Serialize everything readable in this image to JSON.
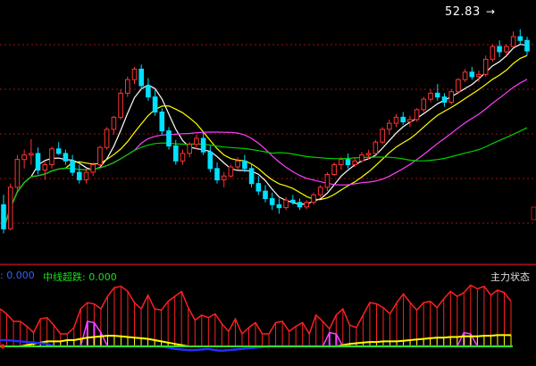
{
  "chart_data": {
    "type": "candlestick",
    "price_label": "52.83",
    "price_arrow": "→",
    "indicator_left_value": ": 0.000",
    "indicator_mid_label": "中线超跌",
    "indicator_mid_value": ": 0.000",
    "indicator_right_label": "主力状态",
    "colors": {
      "up": "#ff3333",
      "down": "#00e0ff",
      "ma5": "#ffffff",
      "ma10": "#ffff00",
      "ma20": "#ff40ff",
      "ma60": "#00d000",
      "grid": "#a01010",
      "ind_red": "#ff2020",
      "ind_magenta": "#ff40ff",
      "ind_yellow": "#ffff00",
      "ind_blue": "#2030ff",
      "ind_green": "#30e030"
    },
    "price_ylim": [
      23,
      55
    ],
    "ind_ylim": [
      0,
      100
    ],
    "candles": [
      [
        30.2,
        31.5,
        26.4,
        27.0
      ],
      [
        27.0,
        33.0,
        26.8,
        32.5
      ],
      [
        32.5,
        36.8,
        32.0,
        36.2
      ],
      [
        36.2,
        37.5,
        35.0,
        36.8
      ],
      [
        36.8,
        38.9,
        35.5,
        37.0
      ],
      [
        37.0,
        37.8,
        34.2,
        34.8
      ],
      [
        34.8,
        36.0,
        33.5,
        35.5
      ],
      [
        35.5,
        37.9,
        35.0,
        37.6
      ],
      [
        37.6,
        38.5,
        36.8,
        37.0
      ],
      [
        37.0,
        37.5,
        35.5,
        36.0
      ],
      [
        36.0,
        36.8,
        34.0,
        34.5
      ],
      [
        34.5,
        35.5,
        33.0,
        33.5
      ],
      [
        33.5,
        35.0,
        33.0,
        34.5
      ],
      [
        34.5,
        35.8,
        34.0,
        35.5
      ],
      [
        35.5,
        38.0,
        35.2,
        37.8
      ],
      [
        37.8,
        40.5,
        37.5,
        40.2
      ],
      [
        40.2,
        42.0,
        39.5,
        41.8
      ],
      [
        41.8,
        45.5,
        41.5,
        45.0
      ],
      [
        45.0,
        47.2,
        44.5,
        46.8
      ],
      [
        46.8,
        48.5,
        46.2,
        48.2
      ],
      [
        48.2,
        48.8,
        45.5,
        46.0
      ],
      [
        46.0,
        47.0,
        44.0,
        44.5
      ],
      [
        44.5,
        45.5,
        42.0,
        42.5
      ],
      [
        42.5,
        43.0,
        39.5,
        40.0
      ],
      [
        40.0,
        40.5,
        37.5,
        38.0
      ],
      [
        38.0,
        38.8,
        35.5,
        36.0
      ],
      [
        36.0,
        37.5,
        35.5,
        37.0
      ],
      [
        37.0,
        38.5,
        36.5,
        38.2
      ],
      [
        38.2,
        39.5,
        37.5,
        39.0
      ],
      [
        39.0,
        39.8,
        36.8,
        37.2
      ],
      [
        37.2,
        38.0,
        34.5,
        35.0
      ],
      [
        35.0,
        35.8,
        33.0,
        33.5
      ],
      [
        33.5,
        34.5,
        32.5,
        34.0
      ],
      [
        34.0,
        35.5,
        33.8,
        35.2
      ],
      [
        35.2,
        36.5,
        34.8,
        36.0
      ],
      [
        36.0,
        36.8,
        34.5,
        35.0
      ],
      [
        35.0,
        35.6,
        32.5,
        33.0
      ],
      [
        33.0,
        34.0,
        31.5,
        32.0
      ],
      [
        32.0,
        32.8,
        30.5,
        31.0
      ],
      [
        31.0,
        31.8,
        29.5,
        30.2
      ],
      [
        30.2,
        31.0,
        29.0,
        29.8
      ],
      [
        29.8,
        31.2,
        29.5,
        30.8
      ],
      [
        30.8,
        31.5,
        30.2,
        30.5
      ],
      [
        30.5,
        31.0,
        29.5,
        29.9
      ],
      [
        29.9,
        30.8,
        29.6,
        30.5
      ],
      [
        30.5,
        31.8,
        30.2,
        31.5
      ],
      [
        31.5,
        32.8,
        31.2,
        32.5
      ],
      [
        32.5,
        34.5,
        32.0,
        34.2
      ],
      [
        34.2,
        35.8,
        34.0,
        35.5
      ],
      [
        35.5,
        36.5,
        34.8,
        36.2
      ],
      [
        36.2,
        37.0,
        35.0,
        35.5
      ],
      [
        35.5,
        36.5,
        35.2,
        36.0
      ],
      [
        36.0,
        37.2,
        35.8,
        36.8
      ],
      [
        36.8,
        37.5,
        36.2,
        37.0
      ],
      [
        37.0,
        38.8,
        36.8,
        38.5
      ],
      [
        38.5,
        40.5,
        38.2,
        40.2
      ],
      [
        40.2,
        41.5,
        39.5,
        41.0
      ],
      [
        41.0,
        42.2,
        40.5,
        41.8
      ],
      [
        41.8,
        42.5,
        40.8,
        41.2
      ],
      [
        41.2,
        42.0,
        40.5,
        41.5
      ],
      [
        41.5,
        43.0,
        41.2,
        42.8
      ],
      [
        42.8,
        44.5,
        42.5,
        44.2
      ],
      [
        44.2,
        45.5,
        43.8,
        45.0
      ],
      [
        45.0,
        46.2,
        44.0,
        44.5
      ],
      [
        44.5,
        45.0,
        43.2,
        43.8
      ],
      [
        43.8,
        45.5,
        43.5,
        45.2
      ],
      [
        45.2,
        47.0,
        45.0,
        46.8
      ],
      [
        46.8,
        48.2,
        46.5,
        47.8
      ],
      [
        47.8,
        48.5,
        46.8,
        47.2
      ],
      [
        47.2,
        48.0,
        46.5,
        47.5
      ],
      [
        47.5,
        50.0,
        47.2,
        49.5
      ],
      [
        49.5,
        51.5,
        49.2,
        51.2
      ],
      [
        51.2,
        52.0,
        49.8,
        50.5
      ],
      [
        50.5,
        51.5,
        50.0,
        51.2
      ],
      [
        51.2,
        53.2,
        51.0,
        52.5
      ],
      [
        52.5,
        53.5,
        51.5,
        52.0
      ],
      [
        52.0,
        52.5,
        50.0,
        50.6
      ]
    ],
    "ind_red": [
      60,
      52,
      40,
      40,
      32,
      22,
      44,
      46,
      34,
      20,
      20,
      30,
      60,
      70,
      68,
      60,
      80,
      94,
      96,
      88,
      70,
      60,
      82,
      60,
      58,
      72,
      80,
      88,
      62,
      42,
      50,
      46,
      52,
      36,
      24,
      44,
      20,
      30,
      38,
      20,
      20,
      38,
      40,
      24,
      32,
      38,
      20,
      50,
      40,
      28,
      50,
      60,
      34,
      30,
      50,
      70,
      68,
      62,
      52,
      70,
      84,
      70,
      58,
      70,
      72,
      62,
      76,
      88,
      80,
      86,
      98,
      92,
      96,
      82,
      90,
      86,
      72
    ],
    "ind_magenta": [
      0,
      0,
      0,
      0,
      0,
      0,
      0,
      0,
      0,
      0,
      0,
      0,
      0,
      40,
      38,
      22,
      0,
      0,
      0,
      0,
      0,
      0,
      0,
      0,
      0,
      0,
      0,
      0,
      0,
      0,
      0,
      0,
      0,
      0,
      0,
      0,
      0,
      0,
      0,
      0,
      0,
      0,
      0,
      0,
      0,
      0,
      0,
      0,
      0,
      22,
      20,
      0,
      0,
      0,
      0,
      0,
      0,
      0,
      0,
      0,
      0,
      0,
      0,
      0,
      0,
      0,
      0,
      0,
      0,
      22,
      20,
      0,
      0,
      0,
      0,
      0,
      0
    ],
    "ind_yellow": [
      0,
      0,
      0,
      0,
      2,
      4,
      6,
      8,
      8,
      8,
      10,
      10,
      12,
      14,
      15,
      16,
      17,
      17,
      16,
      15,
      14,
      13,
      12,
      10,
      8,
      6,
      4,
      2,
      0,
      0,
      0,
      0,
      0,
      0,
      0,
      0,
      0,
      0,
      0,
      0,
      0,
      0,
      0,
      0,
      0,
      0,
      0,
      0,
      0,
      0,
      0,
      2,
      4,
      5,
      6,
      7,
      7,
      8,
      8,
      8,
      9,
      10,
      11,
      12,
      13,
      14,
      14,
      15,
      15,
      16,
      16,
      16,
      17,
      17,
      18,
      18,
      18
    ],
    "ind_blue": [
      10,
      10,
      9,
      8,
      7,
      6,
      5,
      4,
      0,
      0,
      0,
      0,
      0,
      0,
      0,
      0,
      0,
      0,
      0,
      0,
      0,
      0,
      0,
      0,
      0,
      -2,
      -4,
      -5,
      -6,
      -6,
      -5,
      -4,
      -6,
      -7,
      -6,
      -5,
      -4,
      -3,
      -2,
      -1,
      0,
      0,
      0,
      0,
      0,
      0,
      0,
      0,
      0,
      0,
      0,
      0,
      0,
      0,
      0,
      0,
      0,
      0,
      0,
      0,
      0,
      0,
      0,
      0,
      0,
      0,
      0,
      0,
      0,
      0,
      0,
      0,
      0,
      0,
      0,
      0,
      0
    ]
  }
}
